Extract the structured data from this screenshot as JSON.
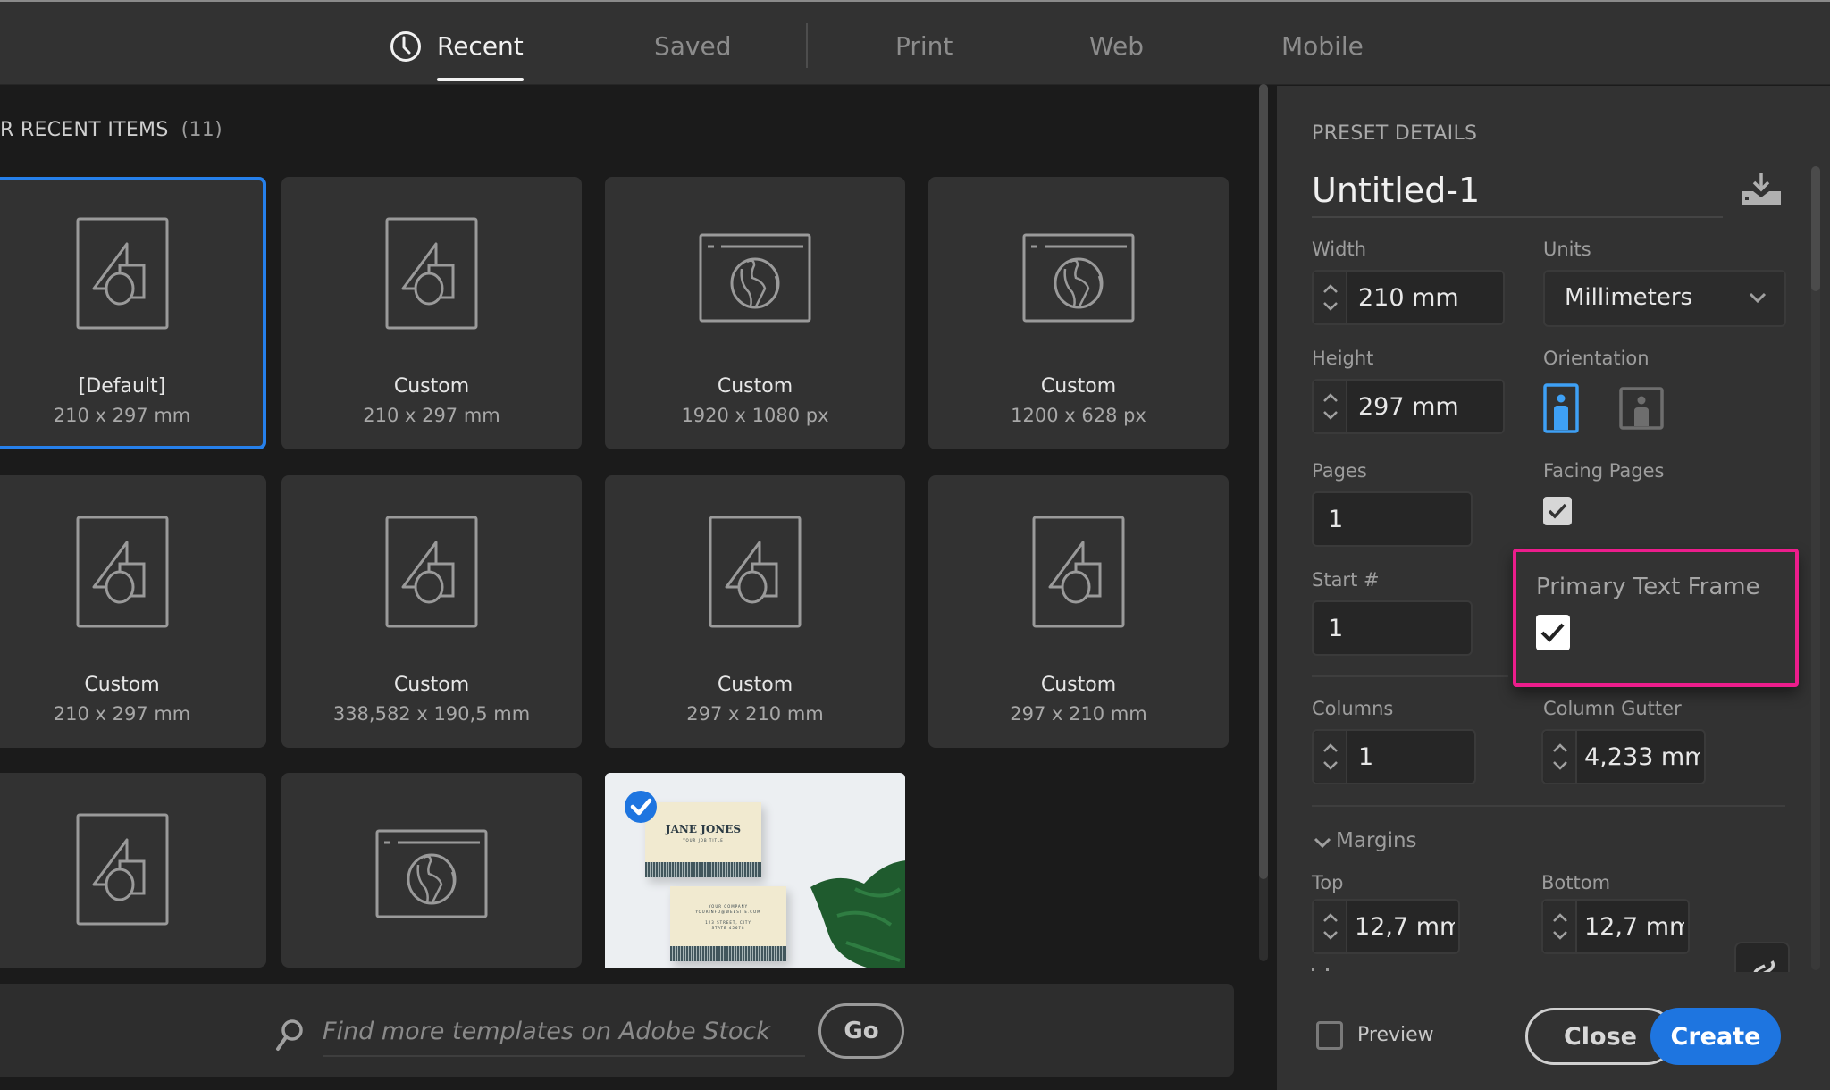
{
  "tabs": [
    {
      "label": "Recent",
      "icon": "clock-icon",
      "active": true
    },
    {
      "label": "Saved",
      "active": false
    },
    {
      "label": "Print",
      "active": false
    },
    {
      "label": "Web",
      "active": false
    },
    {
      "label": "Mobile",
      "active": false
    }
  ],
  "recent": {
    "title": "R RECENT ITEMS",
    "count": "(11)",
    "tiles": [
      {
        "name": "[Default]",
        "size": "210 x 297 mm",
        "icon": "print-document-icon",
        "selected": true
      },
      {
        "name": "Custom",
        "size": "210 x 297 mm",
        "icon": "print-document-icon"
      },
      {
        "name": "Custom",
        "size": "1920 x 1080 px",
        "icon": "web-globe-icon"
      },
      {
        "name": "Custom",
        "size": "1200 x 628 px",
        "icon": "web-globe-icon"
      },
      {
        "name": "Custom",
        "size": "210 x 297 mm",
        "icon": "print-document-icon"
      },
      {
        "name": "Custom",
        "size": "338,582 x 190,5 mm",
        "icon": "print-document-icon"
      },
      {
        "name": "Custom",
        "size": "297 x 210 mm",
        "icon": "print-document-icon"
      },
      {
        "name": "Custom",
        "size": "297 x 210 mm",
        "icon": "print-document-icon"
      },
      {
        "name": "",
        "size": "",
        "icon": "print-document-icon"
      },
      {
        "name": "",
        "size": "",
        "icon": "web-globe-icon"
      },
      {
        "name": "",
        "size": "",
        "icon": "template-thumbnail",
        "thumbnail": {
          "card_name": "JANE JONES",
          "card_subtitle": "YOUR JOB TITLE",
          "back_lines": [
            "YOUR COMPANY",
            "YOURINFO@WEBSITE.COM",
            "123 STREET, CITY",
            "STATE 45678"
          ]
        },
        "checked": true
      }
    ]
  },
  "search": {
    "placeholder": "Find more templates on Adobe Stock",
    "value": "",
    "go_label": "Go"
  },
  "preset": {
    "section_title": "PRESET DETAILS",
    "document_name": "Untitled-1",
    "save_icon": "save-preset-icon",
    "width_label": "Width",
    "width_value": "210 mm",
    "units_label": "Units",
    "units_value": "Millimeters",
    "height_label": "Height",
    "height_value": "297 mm",
    "orientation_label": "Orientation",
    "orientation_selected": "portrait",
    "pages_label": "Pages",
    "pages_value": "1",
    "facing_pages_label": "Facing Pages",
    "facing_pages_checked": true,
    "start_label": "Start #",
    "start_value": "1",
    "primary_text_frame_label": "Primary Text Frame",
    "primary_text_frame_checked": true,
    "columns_label": "Columns",
    "columns_value": "1",
    "gutter_label": "Column Gutter",
    "gutter_value": "4,233 mm",
    "margins_label": "Margins",
    "top_label": "Top",
    "top_value": "12,7 mm",
    "bottom_label": "Bottom",
    "bottom_value": "12,7 mm"
  },
  "footer": {
    "preview_label": "Preview",
    "preview_checked": false,
    "close_label": "Close",
    "create_label": "Create"
  },
  "colors": {
    "accent": "#2680eb",
    "highlight": "#ec1d8c",
    "create_button": "#1e75e0"
  }
}
